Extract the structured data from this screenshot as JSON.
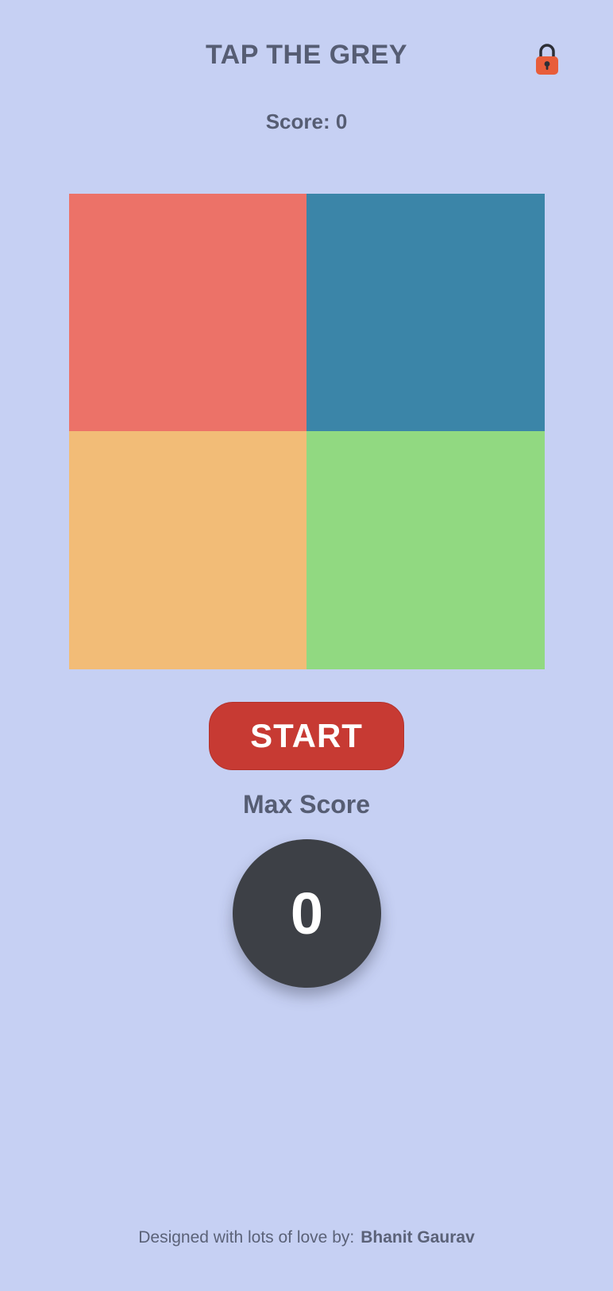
{
  "app": {
    "title": "TAP THE GREY"
  },
  "header": {
    "lock_icon": "padlock-icon",
    "lock_color": "#e85d3a"
  },
  "score": {
    "text": "Score: 0"
  },
  "board": {
    "tiles": [
      {
        "name": "tile-red",
        "color": "#ec7268"
      },
      {
        "name": "tile-blue",
        "color": "#3b85a8"
      },
      {
        "name": "tile-orange",
        "color": "#f2bc77"
      },
      {
        "name": "tile-green",
        "color": "#91d981"
      }
    ]
  },
  "controls": {
    "start_label": "START",
    "start_color": "#c73a33"
  },
  "max_score": {
    "label": "Max Score",
    "value": "0",
    "circle_color": "#3d4046"
  },
  "footer": {
    "text": "Designed with lots of love by:",
    "author": "Bhanit Gaurav"
  }
}
